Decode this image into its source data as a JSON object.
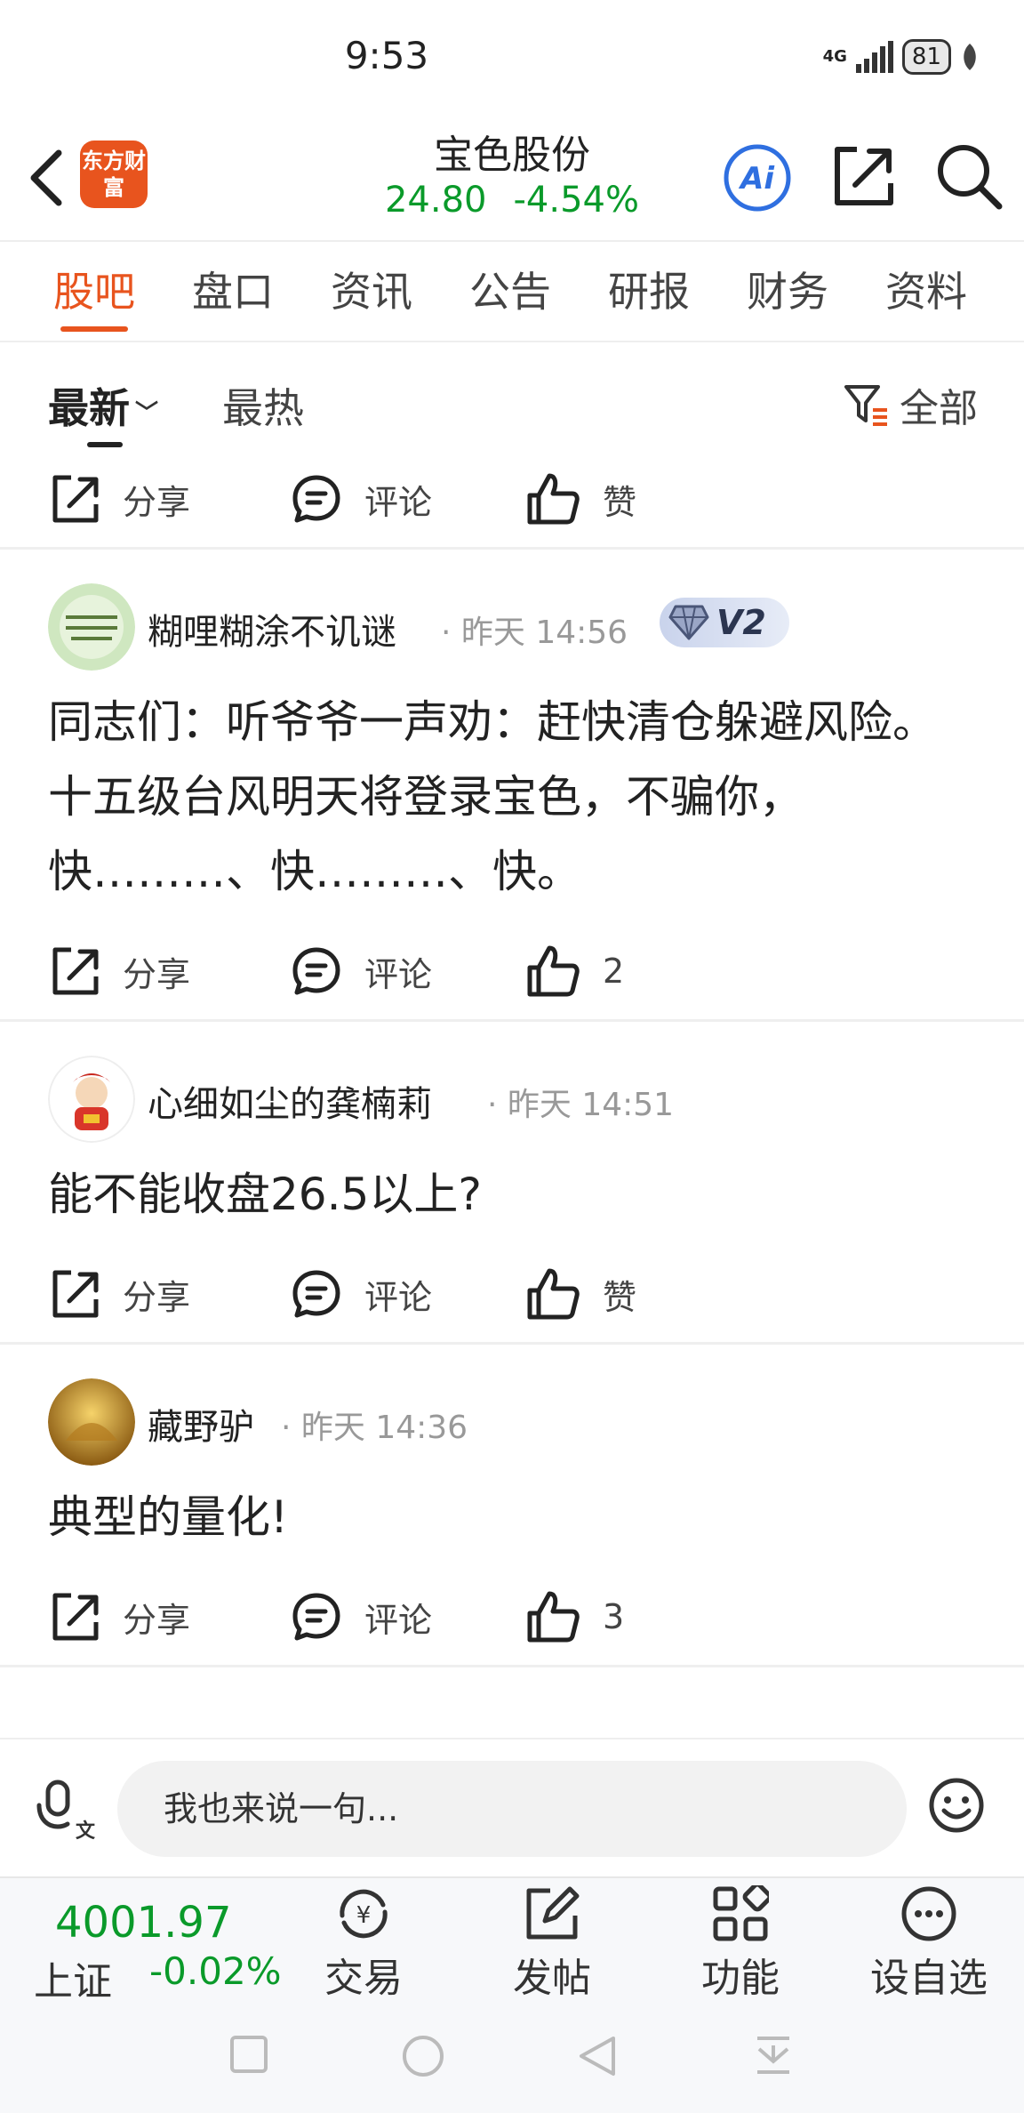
{
  "status_bar": {
    "time": "9:53",
    "network": "4G",
    "battery": "81"
  },
  "header": {
    "logo_text": "东方财富",
    "stock_name": "宝色股份",
    "price": "24.80",
    "change": "-4.54%",
    "ai_label": "Ai"
  },
  "tabs": [
    {
      "label": "股吧",
      "active": true
    },
    {
      "label": "盘口"
    },
    {
      "label": "资讯"
    },
    {
      "label": "公告"
    },
    {
      "label": "研报"
    },
    {
      "label": "财务"
    },
    {
      "label": "资料"
    }
  ],
  "filter": {
    "latest": "最新",
    "hot": "最热",
    "all": "全部"
  },
  "actions_labels": {
    "share": "分享",
    "comment": "评论",
    "like": "赞"
  },
  "top_partial_post": {
    "like": "赞"
  },
  "posts": [
    {
      "author": "糊哩糊涂不讥谜",
      "time": "· 昨天 14:56",
      "badge": "V2",
      "content": "同志们：听爷爷一声劝：赶快清仓躲避风险。十五级台风明天将登录宝色，不骗你，快………、快………、快。",
      "like": "2"
    },
    {
      "author": "心细如尘的龚楠莉",
      "time": "· 昨天 14:51",
      "content": "能不能收盘26.5以上?",
      "like": "赞"
    },
    {
      "author": "藏野驴",
      "time": "· 昨天 14:36",
      "content": "典型的量化!",
      "like": "3"
    }
  ],
  "comment_bar": {
    "placeholder": "我也来说一句..."
  },
  "bottom_nav": {
    "index_value": "4001.97",
    "index_name": "上证",
    "index_change": "-0.02%",
    "trade": "交易",
    "post": "发帖",
    "functions": "功能",
    "watchlist": "设自选"
  },
  "colors": {
    "accent": "#e8541e",
    "down": "#0a9a2a",
    "ai_blue": "#2f6fe0"
  }
}
